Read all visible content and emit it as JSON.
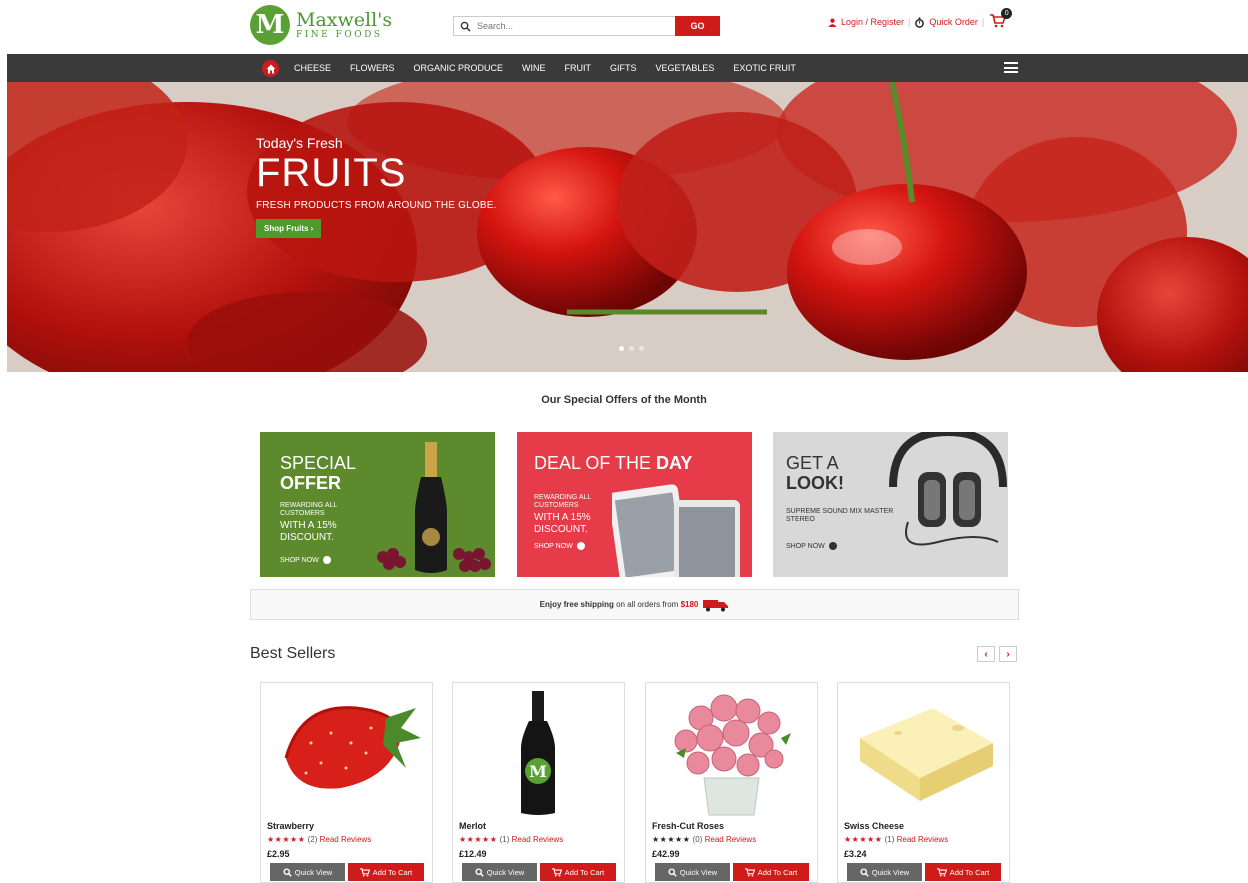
{
  "brand": {
    "mark": "M",
    "name": "Maxwell's",
    "subtitle": "FINE FOODS"
  },
  "search": {
    "placeholder": "Search...",
    "button_label": "GO"
  },
  "header_links": {
    "login": "Login / Register",
    "quick_order": "Quick Order",
    "cart_count": "0"
  },
  "nav": {
    "items": [
      "CHEESE",
      "FLOWERS",
      "ORGANIC PRODUCE",
      "WINE",
      "FRUIT",
      "GIFTS",
      "VEGETABLES",
      "EXOTIC FRUIT"
    ]
  },
  "hero": {
    "subtitle": "Today's Fresh",
    "title": "FRUITS",
    "tagline": "FRESH PRODUCTS FROM AROUND THE GLOBE.",
    "button": "Shop Fruits ›"
  },
  "offers": {
    "title": "Our Special Offers of the Month",
    "o1": {
      "line1": "SPECIAL",
      "line2": "OFFER",
      "small": "REWARDING ALL CUSTOMERS",
      "med": "WITH A 15% DISCOUNT.",
      "cta": "SHOP NOW"
    },
    "o2": {
      "line1": "DEAL OF THE",
      "line1b": "DAY",
      "small": "REWARDING ALL CUSTOMERS",
      "med": "WITH A 15% DISCOUNT.",
      "cta": "SHOP NOW"
    },
    "o3": {
      "line1": "GET A",
      "line2": "LOOK!",
      "small": "SUPREME SOUND MIX MASTER STEREO",
      "cta": "SHOP NOW"
    }
  },
  "shipping": {
    "bold": "Enjoy free shipping",
    "text": " on all orders from ",
    "amount": "$180"
  },
  "best_sellers": {
    "title": "Best Sellers",
    "prev": "‹",
    "next": "›",
    "quick_view": "Quick View",
    "add_to_cart": "Add To Cart",
    "read_reviews": "Read Reviews",
    "products": [
      {
        "name": "Strawberry",
        "stars": "★★★★★",
        "reviews": "(2)",
        "price": "£2.95"
      },
      {
        "name": "Merlot",
        "stars": "★★★★★",
        "reviews": "(1)",
        "price": "£12.49"
      },
      {
        "name": "Fresh-Cut Roses",
        "stars": "★★★★★",
        "reviews": "(0)",
        "price": "£42.99"
      },
      {
        "name": "Swiss Cheese",
        "stars": "★★★★★",
        "reviews": "(1)",
        "price": "£3.24"
      }
    ]
  },
  "colors": {
    "brand_green": "#5aa133",
    "accent_red": "#d01b1b",
    "nav_bg": "#3a3a3a"
  }
}
